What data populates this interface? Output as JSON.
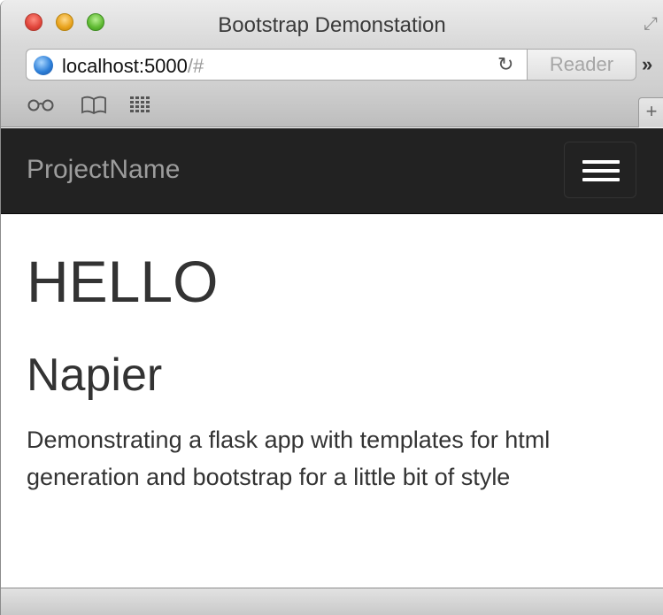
{
  "window": {
    "title": "Bootstrap Demonstation"
  },
  "toolbar": {
    "url_host": "localhost:5000",
    "url_hash": "/#",
    "reader_label": "Reader",
    "reload_glyph": "↻",
    "overflow_glyph": "»"
  },
  "bookmarks": {
    "reading_list_glyph": "oo",
    "book_glyph": "📖",
    "top_sites_glyph": "▦",
    "new_tab_glyph": "+"
  },
  "navbar": {
    "brand": "ProjectName",
    "background": "#222222"
  },
  "page": {
    "heading": "HELLO",
    "subheading": "Napier",
    "lead": "Demonstrating a flask app with templates for html generation and bootstrap for a little bit of style"
  },
  "icons": [
    "close-button",
    "minimize-button",
    "zoom-button",
    "fullscreen-icon",
    "globe-icon",
    "reload-icon",
    "overflow-icon",
    "reading-list-icon",
    "bookmarks-icon",
    "top-sites-icon",
    "new-tab-icon",
    "hamburger-icon"
  ]
}
